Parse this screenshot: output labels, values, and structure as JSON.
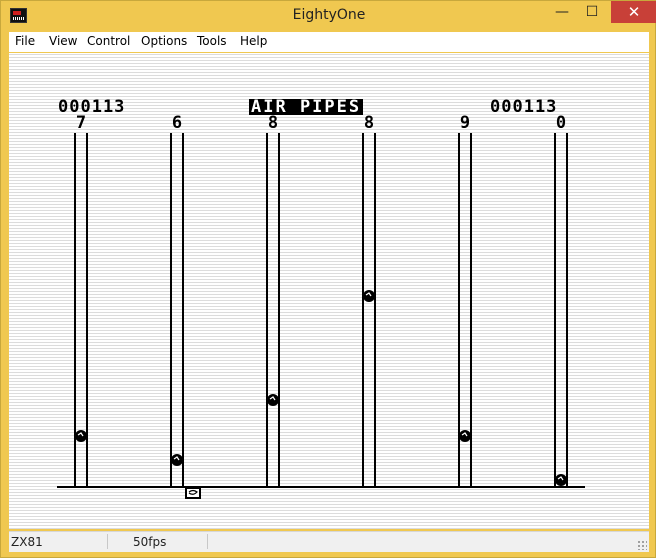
{
  "window": {
    "title": "EightyOne",
    "controls": {
      "minimize": "—",
      "maximize": "☐",
      "close": "✕"
    }
  },
  "menu": {
    "items": [
      {
        "label": "File"
      },
      {
        "label": "View"
      },
      {
        "label": "Control"
      },
      {
        "label": "Options"
      },
      {
        "label": "Tools"
      },
      {
        "label": "Help"
      }
    ]
  },
  "game": {
    "score_left": "000113",
    "title": "AIR PIPES",
    "score_right": "000113",
    "pipe_digits": [
      "7",
      "6",
      "8",
      "8",
      "9",
      "0"
    ]
  },
  "status": {
    "machine": "ZX81",
    "fps": "50fps"
  },
  "colors": {
    "titlebar": "#f0c850",
    "close_button": "#c84038",
    "screen_ink": "#000000",
    "screen_paper": "#ffffff"
  }
}
